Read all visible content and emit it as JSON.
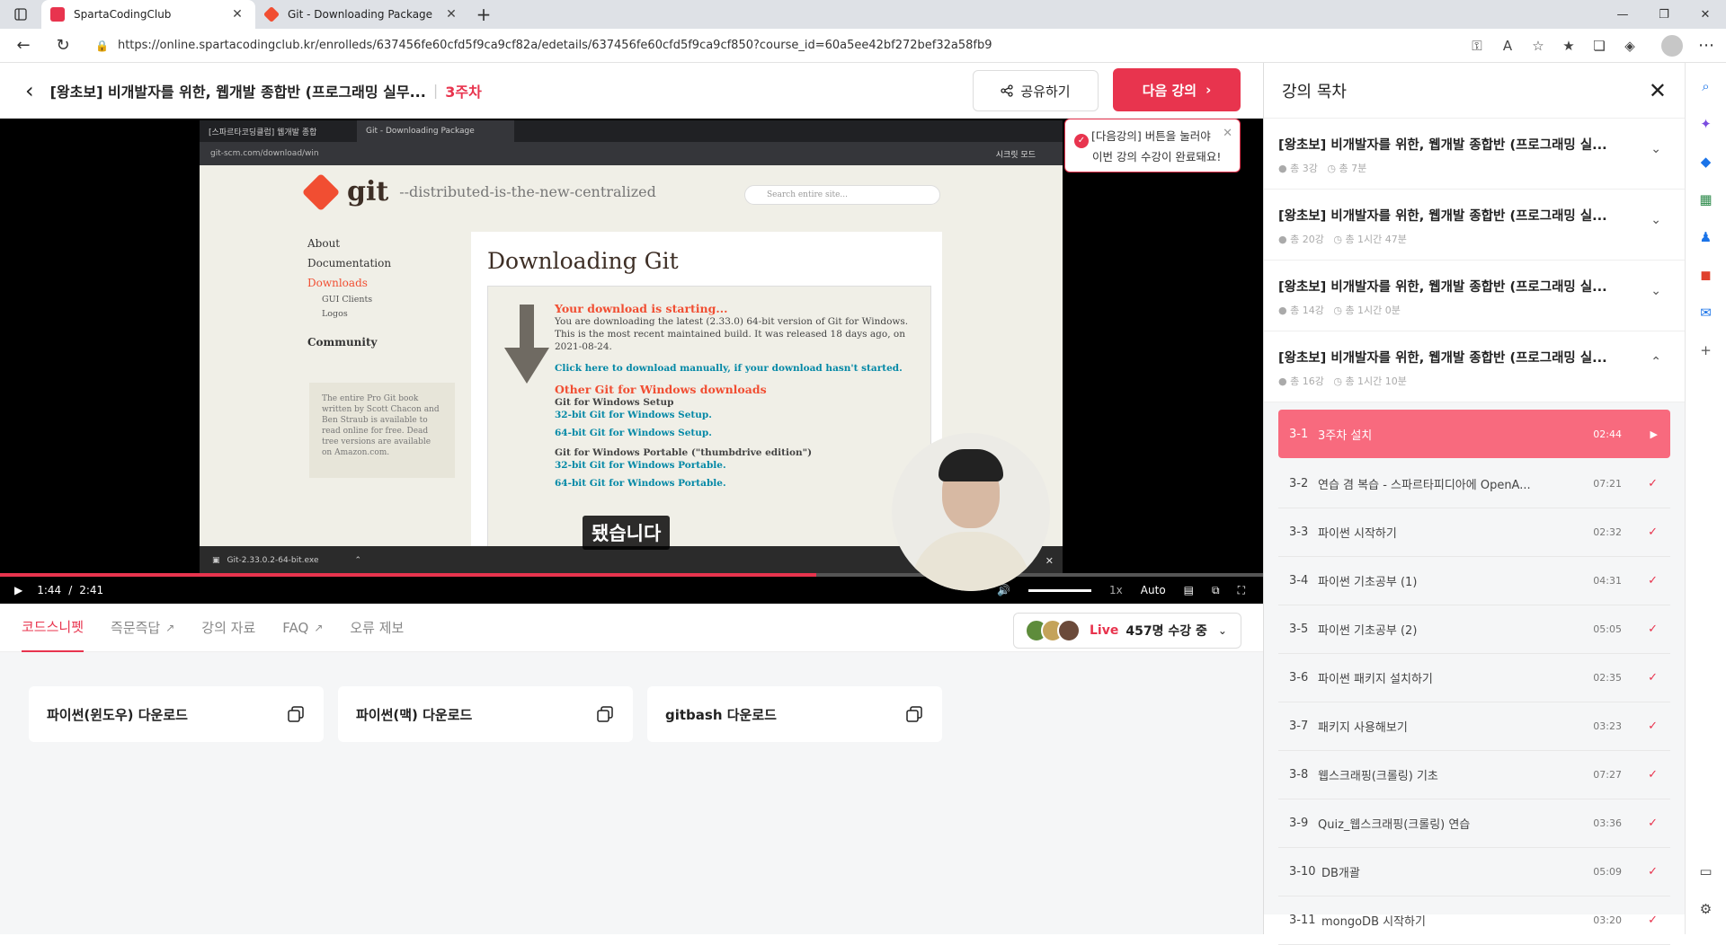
{
  "browser": {
    "tabs": [
      {
        "title": "SpartaCodingClub",
        "active": true
      },
      {
        "title": "Git - Downloading Package",
        "active": false
      }
    ],
    "url": "https://online.spartacodingclub.kr/enrolleds/637456fe60cfd5f9ca9cf82a/edetails/637456fe60cfd5f9ca9cf850?course_id=60a5ee42bf272bef32a58fb9"
  },
  "header": {
    "course_title": "[왕초보] 비개발자를 위한, 웹개발 종합반 (프로그래밍 실무...",
    "week": "3주차",
    "share_label": "공유하기",
    "next_label": "다음 강의"
  },
  "tooltip": {
    "line1": "[다음강의] 버튼을 눌러야",
    "line2": "이번 강의 수강이 완료돼요!"
  },
  "video": {
    "inner_tabs": [
      "[스파르타코딩클럽] 웹개발 종합",
      "Git - Downloading Package"
    ],
    "inner_url": "git-scm.com/download/win",
    "incognito": "시크릿 모드",
    "git_word": "git",
    "git_tagline": "--distributed-is-the-new-centralized",
    "git_search": "Search entire site...",
    "git_nav": [
      "About",
      "Documentation",
      "Downloads",
      "GUI Clients",
      "Logos",
      "Community"
    ],
    "git_book": "The entire Pro Git book written by Scott Chacon and Ben Straub is available to read online for free. Dead tree versions are available on Amazon.com.",
    "heading": "Downloading Git",
    "starting": "Your download is starting...",
    "desc": "You are downloading the latest (2.33.0) 64-bit version of Git for Windows. This is the most recent maintained build. It was released 18 days ago, on 2021-08-24.",
    "click_here": "Click here to download manually, if your download hasn't started.",
    "other": "Other Git for Windows downloads",
    "setup": "Git for Windows Setup",
    "setup32": "32-bit Git for Windows Setup.",
    "setup64": "64-bit Git for Windows Setup.",
    "portable": "Git for Windows Portable (\"thumbdrive edition\")",
    "portable32": "32-bit Git for Windows Portable.",
    "portable64": "64-bit Git for Windows Portable.",
    "download_file": "Git-2.33.0.2-64-bit.exe",
    "caption": "됐습니다",
    "current_time": "1:44",
    "duration": "2:41",
    "progress": 0.646,
    "speed": "1x",
    "quality": "Auto"
  },
  "subtabs": [
    "코드스니펫",
    "즉문즉답",
    "강의 자료",
    "FAQ",
    "오류 제보"
  ],
  "live": {
    "label": "Live",
    "count": "457명 수강 중"
  },
  "snippets": [
    "파이썬(윈도우) 다운로드",
    "파이썬(맥) 다운로드",
    "gitbash 다운로드"
  ],
  "toc": {
    "title": "강의 목차",
    "sections": [
      {
        "title": "[왕초보] 비개발자를 위한, 웹개발 종합반 (프로그래밍 실...",
        "count": "총 3강",
        "time": "총 7분"
      },
      {
        "title": "[왕초보] 비개발자를 위한, 웹개발 종합반 (프로그래밍 실...",
        "count": "총 20강",
        "time": "총 1시간 47분"
      },
      {
        "title": "[왕초보] 비개발자를 위한, 웹개발 종합반 (프로그래밍 실...",
        "count": "총 14강",
        "time": "총 1시간 0분"
      },
      {
        "title": "[왕초보] 비개발자를 위한, 웹개발 종합반 (프로그래밍 실...",
        "count": "총 16강",
        "time": "총 1시간 10분"
      }
    ],
    "lessons": [
      {
        "num": "3-1",
        "title": "3주차 설치",
        "dur": "02:44"
      },
      {
        "num": "3-2",
        "title": "연습 겸 복습 - 스파르타피디아에 OpenA...",
        "dur": "07:21"
      },
      {
        "num": "3-3",
        "title": "파이썬 시작하기",
        "dur": "02:32"
      },
      {
        "num": "3-4",
        "title": "파이썬 기초공부 (1)",
        "dur": "04:31"
      },
      {
        "num": "3-5",
        "title": "파이썬 기초공부 (2)",
        "dur": "05:05"
      },
      {
        "num": "3-6",
        "title": "파이썬 패키지 설치하기",
        "dur": "02:35"
      },
      {
        "num": "3-7",
        "title": "패키지 사용해보기",
        "dur": "03:23"
      },
      {
        "num": "3-8",
        "title": "웹스크래핑(크롤링) 기초",
        "dur": "07:27"
      },
      {
        "num": "3-9",
        "title": "Quiz_웹스크래핑(크롤링) 연습",
        "dur": "03:36"
      },
      {
        "num": "3-10",
        "title": "DB개괄",
        "dur": "05:09"
      },
      {
        "num": "3-11",
        "title": "mongoDB 시작하기",
        "dur": "03:20"
      }
    ]
  },
  "colors": {
    "accent": "#e8344e",
    "accent_light": "#f86a7e"
  }
}
